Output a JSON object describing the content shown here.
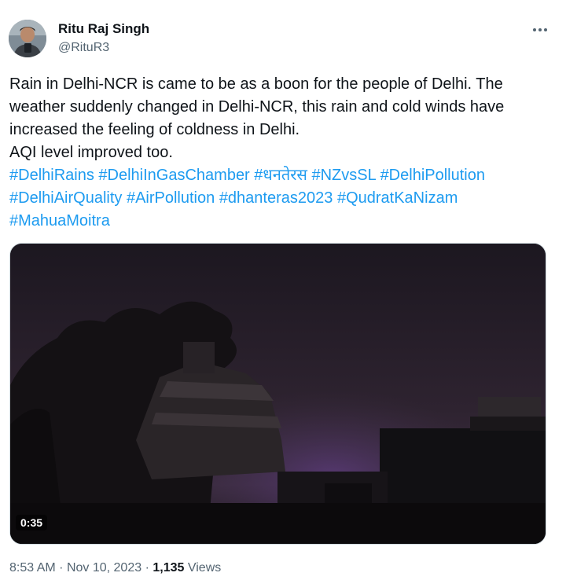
{
  "author": {
    "display_name": "Ritu Raj Singh",
    "handle": "@RituR3"
  },
  "more_icon": "more-horizontal-icon",
  "tweet": {
    "lines": [
      [
        {
          "text": "Rain in Delhi-NCR is came to be as a boon for the people of Delhi. The",
          "hashtag": false
        }
      ],
      [
        {
          "text": "weather suddenly changed in Delhi-NCR, this rain and cold winds have",
          "hashtag": false
        }
      ],
      [
        {
          "text": "increased the feeling of coldness in Delhi.",
          "hashtag": false
        }
      ],
      [
        {
          "text": "AQI level improved too.",
          "hashtag": false
        }
      ],
      [
        {
          "text": "#DelhiRains",
          "hashtag": true
        },
        {
          "text": " ",
          "hashtag": false
        },
        {
          "text": "#DelhiInGasChamber",
          "hashtag": true
        },
        {
          "text": " ",
          "hashtag": false
        },
        {
          "text": "#धनतेरस",
          "hashtag": true
        },
        {
          "text": " ",
          "hashtag": false
        },
        {
          "text": "#NZvsSL",
          "hashtag": true
        },
        {
          "text": " ",
          "hashtag": false
        },
        {
          "text": "#DelhiPollution",
          "hashtag": true
        }
      ],
      [
        {
          "text": "#DelhiAirQuality",
          "hashtag": true
        },
        {
          "text": " ",
          "hashtag": false
        },
        {
          "text": "#AirPollution",
          "hashtag": true
        },
        {
          "text": " ",
          "hashtag": false
        },
        {
          "text": "#dhanteras2023",
          "hashtag": true
        },
        {
          "text": " ",
          "hashtag": false
        },
        {
          "text": "#QudratKaNizam",
          "hashtag": true
        }
      ],
      [
        {
          "text": "#MahuaMoitra",
          "hashtag": true
        }
      ]
    ]
  },
  "media": {
    "duration": "0:35"
  },
  "meta": {
    "time": "8:53 AM",
    "separator": "·",
    "date": "Nov 10, 2023",
    "views_count": "1,135",
    "views_label": "Views"
  },
  "colors": {
    "link": "#1d9bf0",
    "secondary_text": "#536471",
    "primary_text": "#0f1419"
  }
}
